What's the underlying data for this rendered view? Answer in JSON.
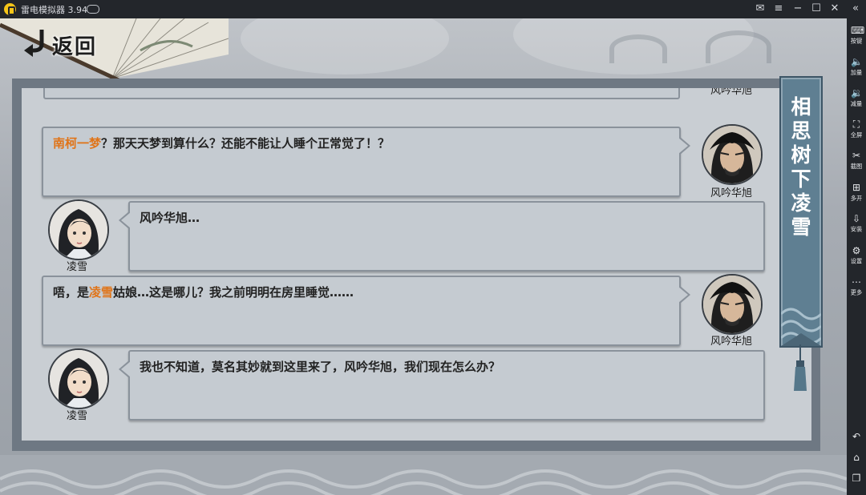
{
  "emulator": {
    "title": "雷电模拟器 3.94",
    "sidebar": [
      {
        "icon": "keyboard-icon",
        "label": "按键"
      },
      {
        "icon": "volume-up-icon",
        "label": "加量"
      },
      {
        "icon": "volume-down-icon",
        "label": "减量"
      },
      {
        "icon": "fullscreen-icon",
        "label": "全屏"
      },
      {
        "icon": "scissors-icon",
        "label": "截图"
      },
      {
        "icon": "multi-instance-icon",
        "label": "多开"
      },
      {
        "icon": "apk-install-icon",
        "label": "安装"
      },
      {
        "icon": "gear-icon",
        "label": "设置"
      },
      {
        "icon": "more-icon",
        "label": "更多"
      }
    ]
  },
  "game": {
    "back_label": "返回",
    "chapter_title": "相思树下凌雪",
    "top_name_fragment": "风吟华旭",
    "messages": [
      {
        "speaker": "风吟华旭",
        "side": "right",
        "parts": [
          {
            "text": "南柯一梦",
            "highlight": true
          },
          {
            "text": "？那天天梦到算什么？还能不能让人睡个正常觉了！？",
            "highlight": false
          }
        ]
      },
      {
        "speaker": "凌雪",
        "side": "left",
        "parts": [
          {
            "text": "风吟华旭…",
            "highlight": false
          }
        ]
      },
      {
        "speaker": "风吟华旭",
        "side": "right",
        "parts": [
          {
            "text": "唔，是",
            "highlight": false
          },
          {
            "text": "凌雪",
            "highlight": true
          },
          {
            "text": "姑娘…这是哪儿？我之前明明在房里睡觉……",
            "highlight": false
          }
        ]
      },
      {
        "speaker": "凌雪",
        "side": "left",
        "parts": [
          {
            "text": "我也不知道，莫名其妙就到这里来了，风吟华旭，我们现在怎么办？",
            "highlight": false
          }
        ]
      }
    ]
  },
  "colors": {
    "highlight": "#e07418",
    "banner": "#5f7f92"
  }
}
